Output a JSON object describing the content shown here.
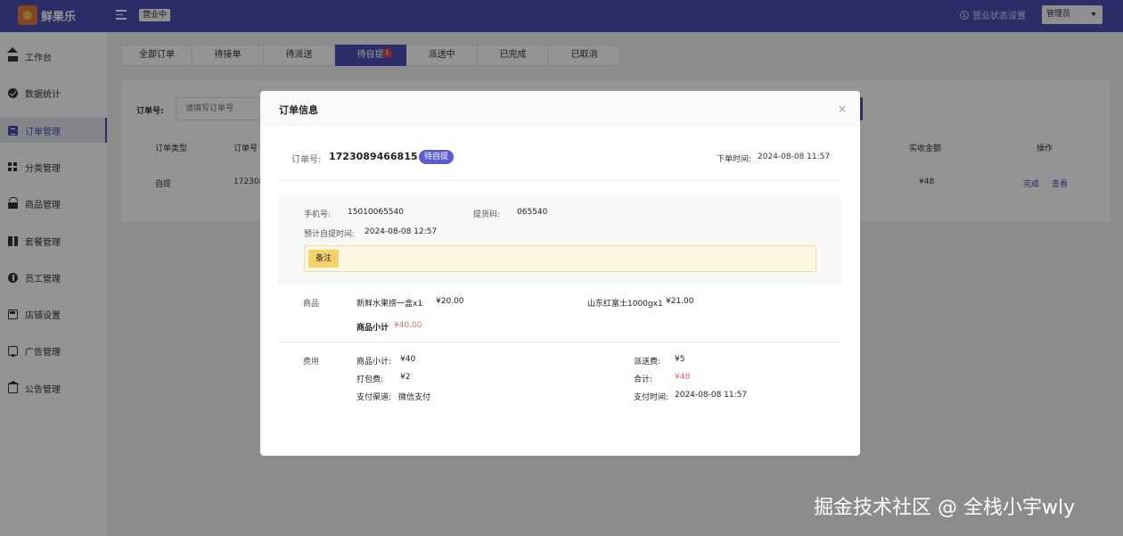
{
  "header": {
    "logo_text": "鲜果乐",
    "status_tag": "营业中",
    "status_settings": "营业状态设置",
    "admin": "管理员"
  },
  "sidebar": {
    "items": [
      {
        "label": "工作台",
        "icon": "home-icon"
      },
      {
        "label": "数据统计",
        "icon": "stats-icon"
      },
      {
        "label": "订单管理",
        "icon": "order-icon",
        "active": true
      },
      {
        "label": "分类管理",
        "icon": "category-icon"
      },
      {
        "label": "商品管理",
        "icon": "goods-icon"
      },
      {
        "label": "套餐管理",
        "icon": "gift-icon"
      },
      {
        "label": "员工管理",
        "icon": "info-icon"
      },
      {
        "label": "店铺设置",
        "icon": "shop-icon"
      },
      {
        "label": "广告管理",
        "icon": "ad-icon"
      },
      {
        "label": "公告管理",
        "icon": "notice-icon"
      }
    ]
  },
  "tabs": [
    {
      "label": "全部订单"
    },
    {
      "label": "待接单"
    },
    {
      "label": "待派送"
    },
    {
      "label": "待自提",
      "active": true,
      "badge": "1"
    },
    {
      "label": "派送中"
    },
    {
      "label": "已完成"
    },
    {
      "label": "已取消"
    }
  ],
  "search": {
    "label": "订单号:",
    "placeholder": "请填写订单号"
  },
  "table": {
    "headers": {
      "type": "订单类型",
      "order_no": "订单号",
      "amount": "实收金额",
      "actions": "操作"
    },
    "row": {
      "type": "自提",
      "order_no": "172308",
      "amount": "¥48",
      "complete": "完成",
      "view": "查看"
    }
  },
  "modal": {
    "title": "订单信息",
    "close": "×",
    "order_label": "订单号:",
    "order_no": "1723089466815",
    "status": "待自提",
    "order_time_label": "下单时间:",
    "order_time": "2024-08-08 11:57",
    "phone_label": "手机号:",
    "phone": "15010065540",
    "pickup_code_label": "提货码:",
    "pickup_code": "065540",
    "pickup_time_label": "预计自提时间:",
    "pickup_time": "2024-08-08 12:57",
    "remark_label": "备注",
    "goods_label": "商品",
    "goods": [
      {
        "name": "新鲜水果捞一盒x1",
        "price": "¥20.00"
      },
      {
        "name": "山东红富士1000gx1",
        "price": "¥21.00"
      }
    ],
    "goods_subtotal_label": "商品小计",
    "goods_subtotal": "¥40.00",
    "fee_label": "费用",
    "fees": {
      "subtotal_label": "商品小计:",
      "subtotal": "¥40",
      "delivery_label": "派送费:",
      "delivery": "¥5",
      "packing_label": "打包费:",
      "packing": "¥2",
      "total_label": "合计:",
      "total": "¥48",
      "channel_label": "支付渠道:",
      "channel": "微信支付",
      "pay_time_label": "支付时间:",
      "pay_time": "2024-08-08 11:57"
    }
  },
  "watermark": "掘金技术社区 @ 全栈小宇wly",
  "colors": {
    "brand": "#4b4fb4",
    "accent_red": "#e06a6a",
    "badge_red": "#e54545",
    "remark_bg": "#fdf7e1"
  }
}
